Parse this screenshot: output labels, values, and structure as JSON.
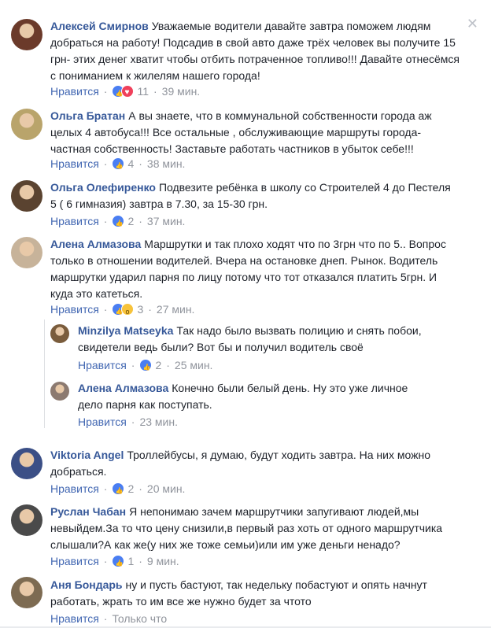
{
  "close_label": "✕",
  "like_label": "Нравится",
  "separator": "·",
  "comments": [
    {
      "author": "Алексей Смирнов",
      "text": "Уважаемые водители давайте завтра поможем людям добраться на работу! Подсадив в свой авто даже трёх человек вы получите 15 грн- этих денег хватит чтобы отбить потраченное топливо!!! Давайте отнесёмся с пониманием к жилелям нашего города!",
      "reactions": [
        "like",
        "love"
      ],
      "count": "11",
      "time": "39 мин."
    },
    {
      "author": "Ольга Братан",
      "text": "А вы знаете, что в коммунальной собственности города аж целых 4 автобуса!!! Все остальные , обслуживающие маршруты города- частная собственность! Заставьте работать частников в убыток себе!!!",
      "reactions": [
        "like"
      ],
      "count": "4",
      "time": "38 мин."
    },
    {
      "author": "Ольга Олефиренко",
      "text": "Подвезите ребёнка в школу со Строителей 4 до Пестеля 5 ( 6 гимназия) завтра в 7.30, за 15-30 грн.",
      "reactions": [
        "like"
      ],
      "count": "2",
      "time": "37 мин."
    },
    {
      "author": "Алена Алмазова",
      "text": "Маршрутки и так плохо ходят что по 3грн что по 5.. Вопрос только в отношении водителей. Вчера на остановке днеп. Рынок. Водитель маршрутки ударил парня по лицу потому что тот отказался платить 5грн. И куда это катеться.",
      "reactions": [
        "like",
        "wow"
      ],
      "count": "3",
      "time": "27 мин."
    },
    {
      "author": "Minzilya Matseyka",
      "text": "Так надо было вызвать полицию и снять побои, свидетели ведь были? Вот бы и получил водитель своё",
      "reactions": [
        "like"
      ],
      "count": "2",
      "time": "25 мин."
    },
    {
      "author": "Алена Алмазова",
      "text": "Конечно были белый день. Ну это уже личное дело парня как поступать.",
      "reactions": [],
      "count": "",
      "time": "23 мин."
    },
    {
      "author": "Viktoria Angel",
      "text": "Троллейбусы, я думаю, будут ходить завтра. На них можно добраться.",
      "reactions": [
        "like"
      ],
      "count": "2",
      "time": "20 мин."
    },
    {
      "author": "Руслан Чабан",
      "text": "Я непонимаю зачем маршрутчики запугивают людей,мы невыйдем.За то что цену снизили,в первый раз хоть от одного маршрутчика слышали?А как же(у них же тоже семьи)или им уже деньги ненадо?",
      "reactions": [
        "like"
      ],
      "count": "1",
      "time": "9 мин."
    },
    {
      "author": "Аня Бондарь",
      "text": "ну и пусть бастуют, так недельку побастуют и опять начнут работать, жрать то им все же нужно будет за чтото",
      "reactions": [],
      "count": "",
      "time": "Только что"
    }
  ],
  "avatar_colors": [
    "#6b3a2a",
    "#b9a46b",
    "#5a4330",
    "#c7b39a",
    "#7a5c3c",
    "#8c7a70",
    "#3b4f86",
    "#4a4a4a",
    "#7d6b52"
  ]
}
